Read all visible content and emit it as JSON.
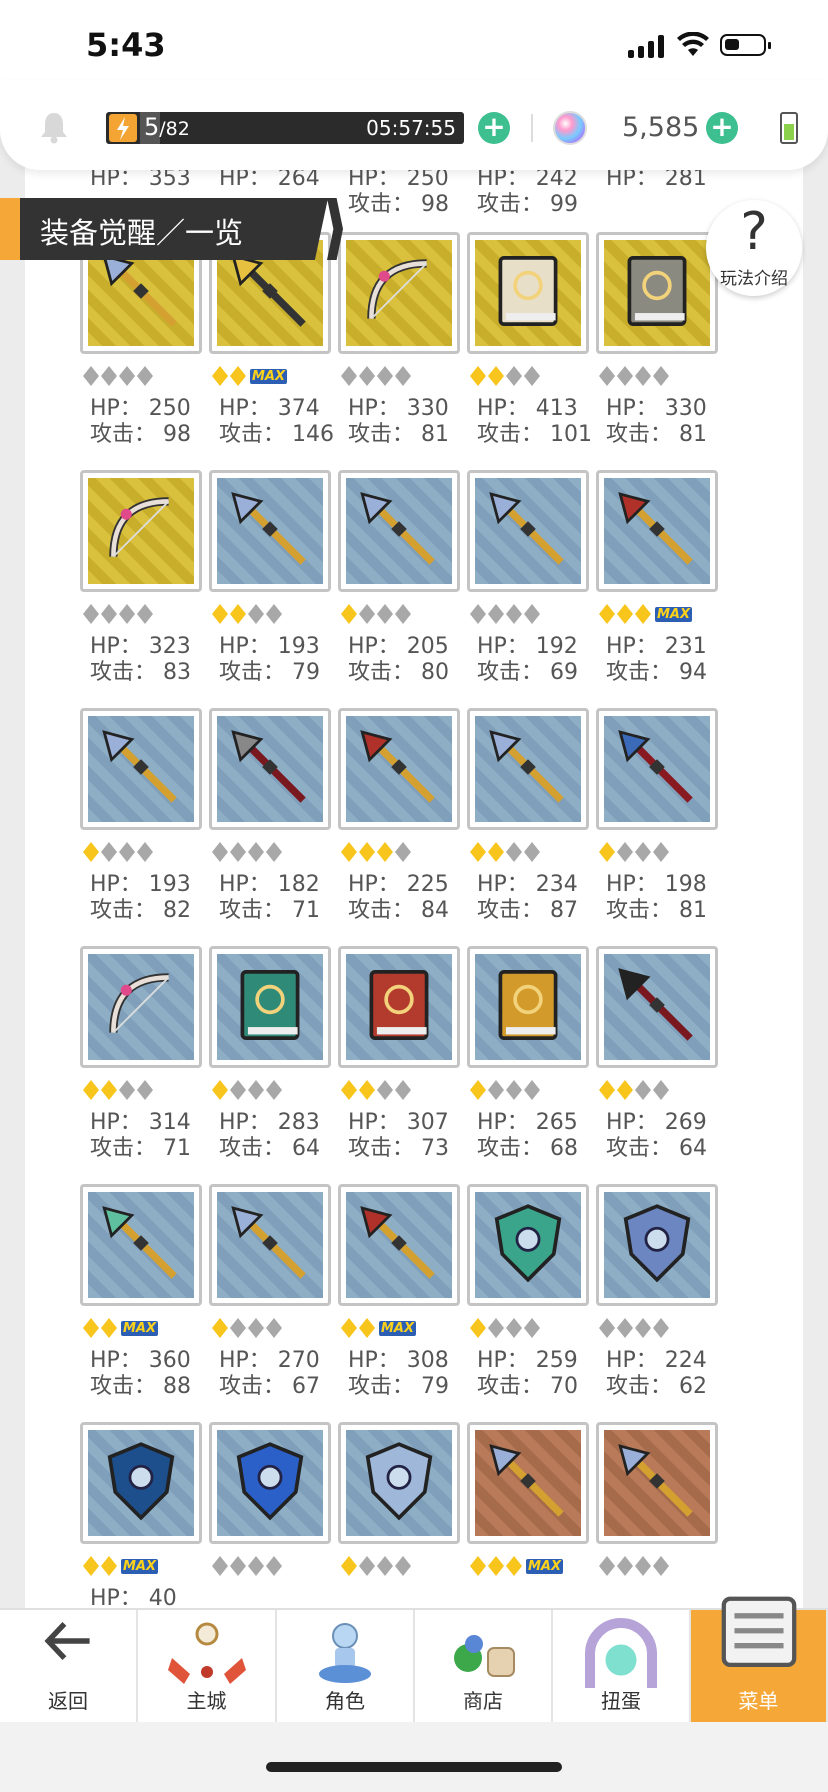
{
  "status": {
    "time": "5:43"
  },
  "topbar": {
    "energy_current": "5",
    "energy_max": "/82",
    "energy_timer": "05:57:55",
    "gems": "5,585"
  },
  "header": {
    "title": "装备觉醒／一览"
  },
  "help": {
    "symbol": "?",
    "label": "玩法介绍"
  },
  "labels": {
    "hp": "HP：",
    "atk": "攻击："
  },
  "partial_top": [
    {
      "hp": "353",
      "atk": ""
    },
    {
      "hp": "264",
      "atk": ""
    },
    {
      "hp": "250",
      "atk": "98"
    },
    {
      "hp": "242",
      "atk": "99"
    },
    {
      "hp": "281",
      "atk": ""
    }
  ],
  "rows": [
    [
      {
        "bg": "gold",
        "icon": "halberd-icon",
        "stars": 0,
        "max": false,
        "hp": "250",
        "atk": "98"
      },
      {
        "bg": "gold",
        "icon": "golden-staff-icon",
        "stars": 2,
        "max": true,
        "hp": "374",
        "atk": "146"
      },
      {
        "bg": "gold",
        "icon": "bow-icon",
        "stars": 0,
        "max": false,
        "hp": "330",
        "atk": "81"
      },
      {
        "bg": "gold",
        "icon": "scroll-book-icon",
        "stars": 2,
        "max": false,
        "hp": "413",
        "atk": "101"
      },
      {
        "bg": "gold",
        "icon": "stone-book-icon",
        "stars": 0,
        "max": false,
        "hp": "330",
        "atk": "81"
      }
    ],
    [
      {
        "bg": "gold",
        "icon": "crossbow-icon",
        "stars": 0,
        "max": false,
        "hp": "323",
        "atk": "83"
      },
      {
        "bg": "blue",
        "icon": "greatsword-icon",
        "stars": 2,
        "max": false,
        "hp": "193",
        "atk": "79"
      },
      {
        "bg": "blue",
        "icon": "dagger-icon",
        "stars": 1,
        "max": false,
        "hp": "205",
        "atk": "80"
      },
      {
        "bg": "blue",
        "icon": "wavy-dagger-icon",
        "stars": 0,
        "max": false,
        "hp": "192",
        "atk": "69"
      },
      {
        "bg": "blue",
        "icon": "axe-icon",
        "stars": 3,
        "max": true,
        "hp": "231",
        "atk": "94"
      }
    ],
    [
      {
        "bg": "blue",
        "icon": "pickaxe-icon",
        "stars": 1,
        "max": false,
        "hp": "193",
        "atk": "82"
      },
      {
        "bg": "blue",
        "icon": "battle-axe-icon",
        "stars": 0,
        "max": false,
        "hp": "182",
        "atk": "71"
      },
      {
        "bg": "blue",
        "icon": "red-spear-icon",
        "stars": 3,
        "max": false,
        "hp": "225",
        "atk": "84"
      },
      {
        "bg": "blue",
        "icon": "spear-icon",
        "stars": 2,
        "max": false,
        "hp": "234",
        "atk": "87"
      },
      {
        "bg": "blue",
        "icon": "scythe-icon",
        "stars": 1,
        "max": false,
        "hp": "198",
        "atk": "81"
      }
    ],
    [
      {
        "bg": "blue",
        "icon": "recurve-bow-icon",
        "stars": 2,
        "max": false,
        "hp": "314",
        "atk": "71"
      },
      {
        "bg": "blue",
        "icon": "green-book-icon",
        "stars": 1,
        "max": false,
        "hp": "283",
        "atk": "64"
      },
      {
        "bg": "blue",
        "icon": "red-book-icon",
        "stars": 2,
        "max": false,
        "hp": "307",
        "atk": "73"
      },
      {
        "bg": "blue",
        "icon": "gold-book-icon",
        "stars": 1,
        "max": false,
        "hp": "265",
        "atk": "68"
      },
      {
        "bg": "blue",
        "icon": "skull-pickaxe-icon",
        "stars": 2,
        "max": false,
        "hp": "269",
        "atk": "64"
      }
    ],
    [
      {
        "bg": "blue",
        "icon": "green-wand-icon",
        "stars": 2,
        "max": true,
        "hp": "360",
        "atk": "88"
      },
      {
        "bg": "blue",
        "icon": "blue-scepter-icon",
        "stars": 1,
        "max": false,
        "hp": "270",
        "atk": "67"
      },
      {
        "bg": "blue",
        "icon": "red-scepter-icon",
        "stars": 2,
        "max": true,
        "hp": "308",
        "atk": "79"
      },
      {
        "bg": "blue",
        "icon": "green-gauntlet-icon",
        "stars": 1,
        "max": false,
        "hp": "259",
        "atk": "70"
      },
      {
        "bg": "blue",
        "icon": "spiked-buckler-icon",
        "stars": 0,
        "max": false,
        "hp": "224",
        "atk": "62"
      }
    ],
    [
      {
        "bg": "blue",
        "icon": "tower-shield-icon",
        "stars": 2,
        "max": true,
        "hp": "40",
        "atk": ""
      },
      {
        "bg": "blue",
        "icon": "round-shield-icon",
        "stars": 0,
        "max": false,
        "hp": "",
        "atk": ""
      },
      {
        "bg": "blue",
        "icon": "winged-shield-icon",
        "stars": 1,
        "max": false,
        "hp": "",
        "atk": ""
      },
      {
        "bg": "bronze",
        "icon": "sword-icon",
        "stars": 3,
        "max": true,
        "hp": "",
        "atk": ""
      },
      {
        "bg": "bronze",
        "icon": "double-axe-icon",
        "stars": 0,
        "max": false,
        "hp": "",
        "atk": ""
      }
    ]
  ],
  "nav": [
    {
      "name": "nav-back",
      "label": "返回",
      "icon": "back-arrow-icon"
    },
    {
      "name": "nav-main-city",
      "label": "主城",
      "icon": "city-icon"
    },
    {
      "name": "nav-character",
      "label": "角色",
      "icon": "character-icon"
    },
    {
      "name": "nav-shop",
      "label": "商店",
      "icon": "shop-icon"
    },
    {
      "name": "nav-gacha",
      "label": "扭蛋",
      "icon": "gacha-icon"
    },
    {
      "name": "nav-menu",
      "label": "菜单",
      "icon": "menu-icon"
    }
  ],
  "colors": {
    "accent": "#f5a838",
    "plus": "#3dbf8f",
    "star": "#f7c51c",
    "dark": "#333333"
  }
}
